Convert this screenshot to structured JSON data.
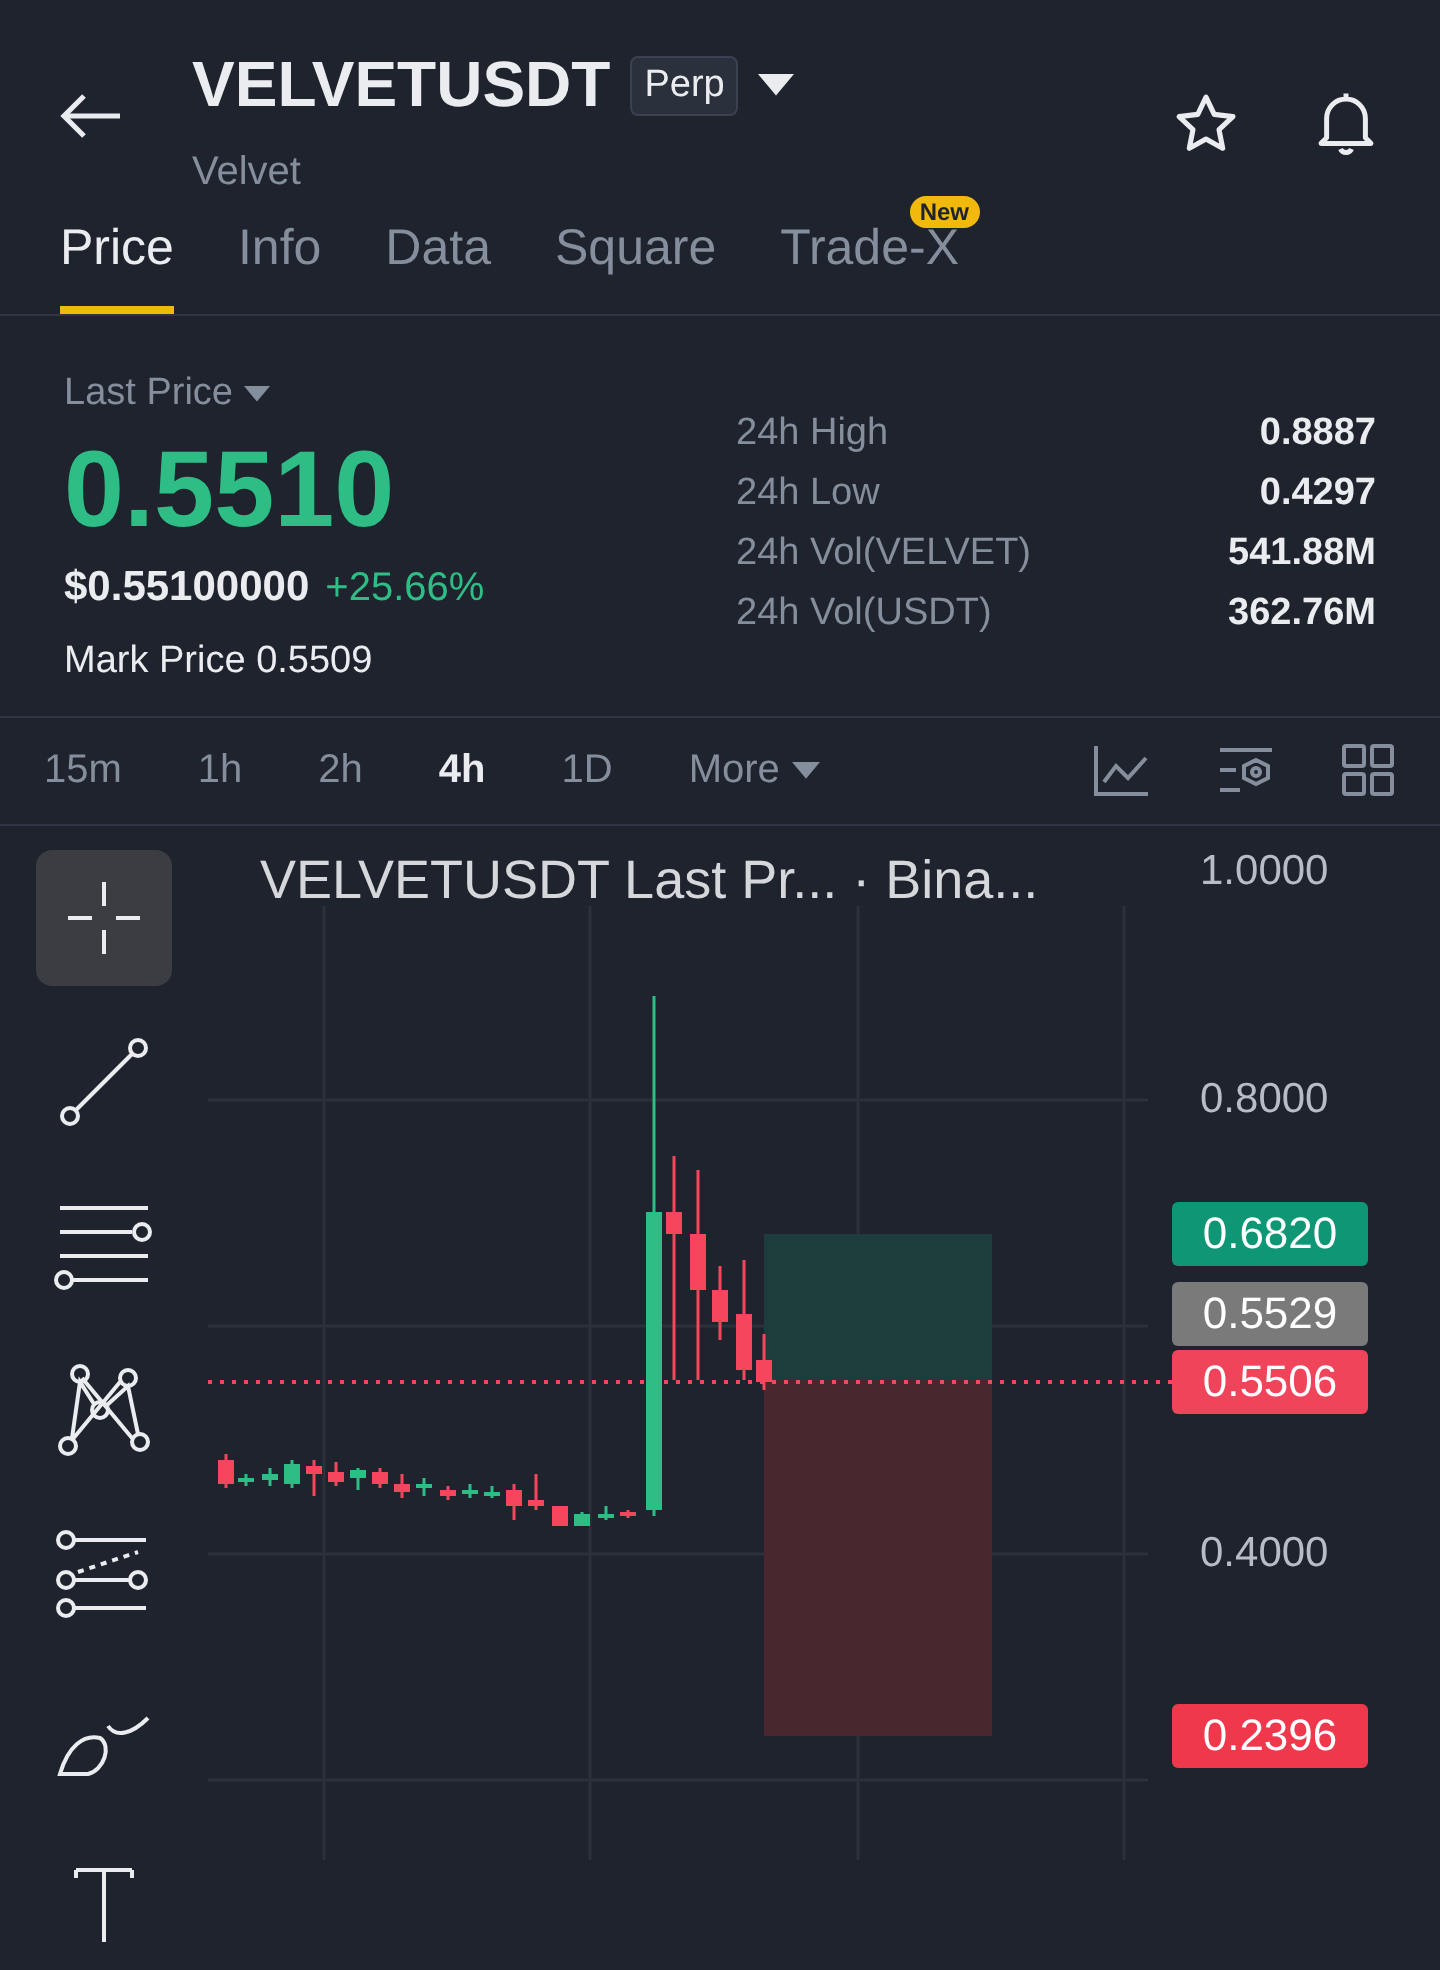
{
  "header": {
    "symbol": "VELVETUSDT",
    "contract": "Perp",
    "name": "Velvet",
    "favorite": false
  },
  "tabs": [
    {
      "label": "Price",
      "selected": true
    },
    {
      "label": "Info",
      "selected": false
    },
    {
      "label": "Data",
      "selected": false
    },
    {
      "label": "Square",
      "selected": false
    },
    {
      "label": "Trade-X",
      "selected": false,
      "badge": "New"
    }
  ],
  "price": {
    "selector": "Last Price",
    "last": "0.5510",
    "usd": "$0.55100000",
    "change": "+25.66%",
    "mark_label": "Mark Price",
    "mark": "0.5509",
    "stats": [
      {
        "label": "24h High",
        "value": "0.8887"
      },
      {
        "label": "24h Low",
        "value": "0.4297"
      },
      {
        "label": "24h Vol(VELVET)",
        "value": "541.88M"
      },
      {
        "label": "24h Vol(USDT)",
        "value": "362.76M"
      }
    ]
  },
  "intervals": [
    {
      "label": "15m",
      "selected": false
    },
    {
      "label": "1h",
      "selected": false
    },
    {
      "label": "2h",
      "selected": false
    },
    {
      "label": "4h",
      "selected": true
    },
    {
      "label": "1D",
      "selected": false
    },
    {
      "label": "More",
      "selected": false,
      "menu": true
    }
  ],
  "tools": [
    {
      "kind": "crosshair",
      "selected": true
    },
    {
      "kind": "trendline",
      "selected": false
    },
    {
      "kind": "lines",
      "selected": false
    },
    {
      "kind": "pattern",
      "selected": false
    },
    {
      "kind": "fib",
      "selected": false
    },
    {
      "kind": "brush",
      "selected": false
    },
    {
      "kind": "text",
      "selected": false
    }
  ],
  "chart": {
    "title": "VELVETUSDT Last Pr... · Bina...",
    "axis": [
      "1.0000",
      "0.8000",
      "0.4000"
    ],
    "tags": [
      {
        "value": "0.6820",
        "color": "#0f9675"
      },
      {
        "value": "0.5529",
        "color": "#7a7a7a"
      },
      {
        "value": "0.5506",
        "color": "#f0445a"
      },
      {
        "value": "0.2396",
        "color": "#f0384c"
      }
    ]
  }
}
